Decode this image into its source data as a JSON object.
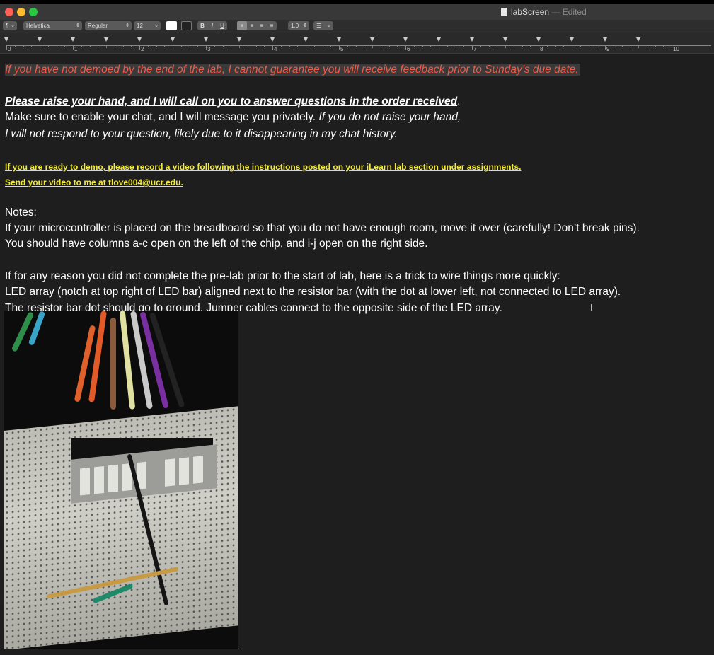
{
  "window": {
    "title": "labScreen",
    "status": "— Edited"
  },
  "toolbar": {
    "paragraph_style": "¶",
    "font_family": "Helvetica",
    "font_style": "Regular",
    "font_size": "12",
    "bold_label": "B",
    "italic_label": "I",
    "underline_label": "U",
    "line_spacing": "1.0",
    "list_label": "☰"
  },
  "ruler": {
    "numbers": [
      "0",
      "1",
      "2",
      "3",
      "4",
      "5",
      "6",
      "7",
      "8",
      "9",
      "10"
    ]
  },
  "document": {
    "red_line": "If you have not demoed by the end of the lab, I cannot guarantee you will receive feedback prior to Sunday’s due date.",
    "raise_hand_bold": "Please raise your hand, and I will call on you to answer questions in the order received",
    "raise_hand_period": ".",
    "chat_line_regular": " Make sure to enable your chat, and I will message you privately. ",
    "chat_line_italic": "If you do not raise your hand,",
    "chat_line_2": "I will not respond to your question, likely due to it disappearing in my chat history.",
    "yellow_line_1": "If you are ready to demo, please record a video following the instructions posted on your iLearn lab section under assignments.",
    "yellow_line_2": "Send your video to me at tlove004@ucr.edu.",
    "notes_heading": "Notes:",
    "notes_1": "If your microcontroller is placed on the breadboard so that you do not have enough room, move it over (carefully! Don’t break pins).",
    "notes_2": "You should have columns a-c open on the left of the chip, and i-j open on the right side.",
    "prelab_1": "If for any reason you did not complete the pre-lab prior to the start of lab, here is a trick to wire things more quickly:",
    "prelab_2": "LED array (notch at top right of LED bar) aligned next to the resistor bar (with the dot at lower left, not connected to LED array).",
    "prelab_3": "The resistor bar dot should go to ground.  Jumper cables connect to the opposite side of the LED array."
  },
  "colors": {
    "red_text": "#f05a4a",
    "yellow_text": "#f2ea3c",
    "background": "#1e1e1e"
  }
}
